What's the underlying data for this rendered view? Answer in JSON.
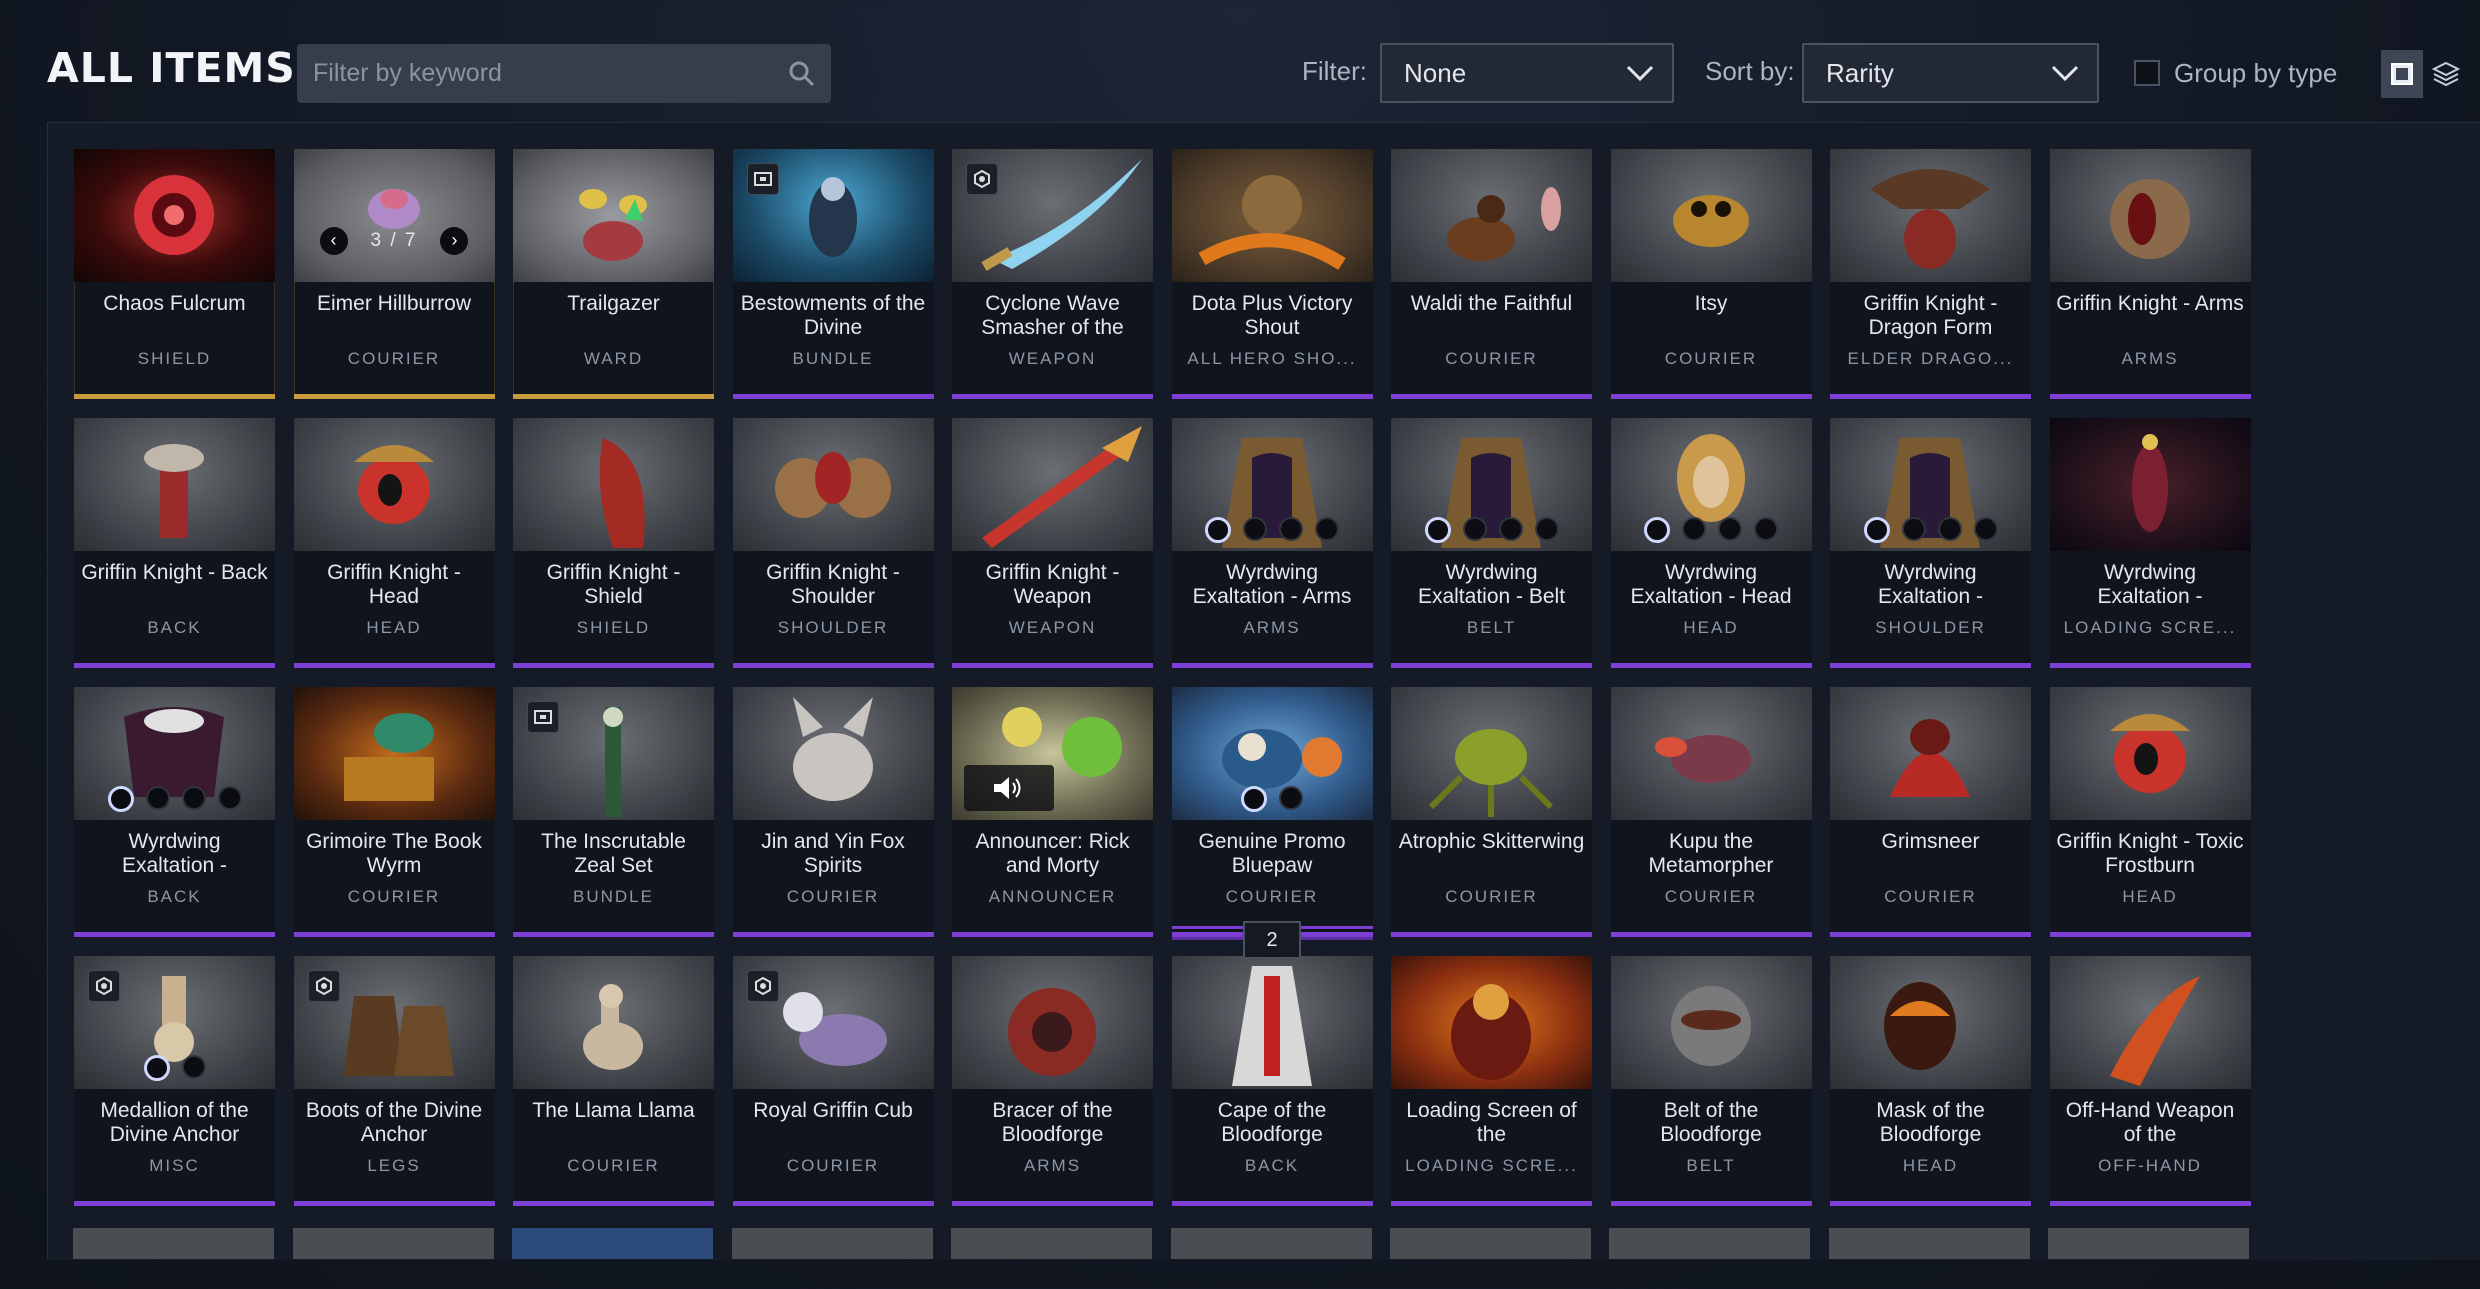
{
  "header": {
    "title": "ALL ITEMS",
    "search_placeholder": "Filter by keyword",
    "filter_label": "Filter:",
    "filter_value": "None",
    "sort_label": "Sort by:",
    "sort_value": "Rarity",
    "group_label": "Group by type"
  },
  "items": [
    {
      "name": "Chaos Fulcrum",
      "type": "SHIELD",
      "rarity": "gold",
      "art": "chaos"
    },
    {
      "name": "Eimer Hillburrow",
      "type": "COURIER",
      "rarity": "gold",
      "art": "eimer",
      "nav": "3 / 7"
    },
    {
      "name": "Trailgazer",
      "type": "WARD",
      "rarity": "gold",
      "art": "trail"
    },
    {
      "name": "Bestowments of the Divine",
      "type": "BUNDLE",
      "rarity": "purple",
      "art": "divine",
      "badge": "bundle"
    },
    {
      "name": "Cyclone Wave Smasher of the",
      "type": "WEAPON",
      "rarity": "purple",
      "art": "cyclone",
      "badge": "style"
    },
    {
      "name": "Dota Plus Victory Shout",
      "type": "ALL HERO SHO...",
      "rarity": "purple",
      "art": "dotaplus"
    },
    {
      "name": "Waldi the Faithful",
      "type": "COURIER",
      "rarity": "purple",
      "art": "waldi"
    },
    {
      "name": "Itsy",
      "type": "COURIER",
      "rarity": "purple",
      "art": "itsy"
    },
    {
      "name": "Griffin Knight - Dragon Form",
      "type": "ELDER DRAGO...",
      "rarity": "purple",
      "art": "griffin"
    },
    {
      "name": "Griffin Knight - Arms",
      "type": "ARMS",
      "rarity": "purple",
      "art": "gkarms"
    },
    {
      "name": "Griffin Knight - Back",
      "type": "BACK",
      "rarity": "purple",
      "art": "gkback"
    },
    {
      "name": "Griffin Knight - Head",
      "type": "HEAD",
      "rarity": "purple",
      "art": "gkhead"
    },
    {
      "name": "Griffin Knight - Shield",
      "type": "SHIELD",
      "rarity": "purple",
      "art": "gkshield"
    },
    {
      "name": "Griffin Knight - Shoulder",
      "type": "SHOULDER",
      "rarity": "purple",
      "art": "gkshoulder"
    },
    {
      "name": "Griffin Knight - Weapon",
      "type": "WEAPON",
      "rarity": "purple",
      "art": "gkweapon"
    },
    {
      "name": "Wyrdwing Exaltation - Arms",
      "type": "ARMS",
      "rarity": "purple",
      "art": "wyrd",
      "dots": 4
    },
    {
      "name": "Wyrdwing Exaltation - Belt",
      "type": "BELT",
      "rarity": "purple",
      "art": "wyrd",
      "dots": 4
    },
    {
      "name": "Wyrdwing Exaltation - Head",
      "type": "HEAD",
      "rarity": "purple",
      "art": "wyrdhead",
      "dots": 4
    },
    {
      "name": "Wyrdwing Exaltation -",
      "type": "SHOULDER",
      "rarity": "purple",
      "art": "wyrd",
      "dots": 4
    },
    {
      "name": "Wyrdwing Exaltation -",
      "type": "LOADING SCRE...",
      "rarity": "purple",
      "art": "wyrdload"
    },
    {
      "name": "Wyrdwing Exaltation -",
      "type": "BACK",
      "rarity": "purple",
      "art": "wyrdback",
      "dots": 4
    },
    {
      "name": "Grimoire The Book Wyrm",
      "type": "COURIER",
      "rarity": "purple",
      "art": "grimoire"
    },
    {
      "name": "The Inscrutable Zeal Set",
      "type": "BUNDLE",
      "rarity": "purple",
      "art": "zeal",
      "badge": "bundle"
    },
    {
      "name": "Jin and Yin Fox Spirits",
      "type": "COURIER",
      "rarity": "purple",
      "art": "fox"
    },
    {
      "name": "Announcer: Rick and Morty",
      "type": "ANNOUNCER",
      "rarity": "purple",
      "art": "rick",
      "speaker": true
    },
    {
      "name": "Genuine Promo Bluepaw",
      "type": "COURIER",
      "rarity": "purple",
      "art": "bluepaw",
      "dots": 2,
      "stack": "2"
    },
    {
      "name": "Atrophic Skitterwing",
      "type": "COURIER",
      "rarity": "purple",
      "art": "skitter"
    },
    {
      "name": "Kupu the Metamorpher",
      "type": "COURIER",
      "rarity": "purple",
      "art": "kupu"
    },
    {
      "name": "Grimsneer",
      "type": "COURIER",
      "rarity": "purple",
      "art": "grimsneer"
    },
    {
      "name": "Griffin Knight - Toxic Frostburn",
      "type": "HEAD",
      "rarity": "purple",
      "art": "gkhead"
    },
    {
      "name": "Medallion of the Divine Anchor",
      "type": "MISC",
      "rarity": "purple",
      "art": "medallion",
      "badge": "style",
      "dots": 2
    },
    {
      "name": "Boots of the Divine Anchor",
      "type": "LEGS",
      "rarity": "purple",
      "art": "boots",
      "badge": "style"
    },
    {
      "name": "The Llama Llama",
      "type": "COURIER",
      "rarity": "purple",
      "art": "llama"
    },
    {
      "name": "Royal Griffin Cub",
      "type": "COURIER",
      "rarity": "purple",
      "art": "cub",
      "badge": "style"
    },
    {
      "name": "Bracer of the Bloodforge",
      "type": "ARMS",
      "rarity": "purple",
      "art": "bracer"
    },
    {
      "name": "Cape of the Bloodforge",
      "type": "BACK",
      "rarity": "purple",
      "art": "cape"
    },
    {
      "name": "Loading Screen of the",
      "type": "LOADING SCRE...",
      "rarity": "purple",
      "art": "loading"
    },
    {
      "name": "Belt of the Bloodforge",
      "type": "BELT",
      "rarity": "purple",
      "art": "belt"
    },
    {
      "name": "Mask of the Bloodforge",
      "type": "HEAD",
      "rarity": "purple",
      "art": "mask"
    },
    {
      "name": "Off-Hand Weapon of the",
      "type": "OFF-HAND",
      "rarity": "purple",
      "art": "offhand"
    }
  ]
}
